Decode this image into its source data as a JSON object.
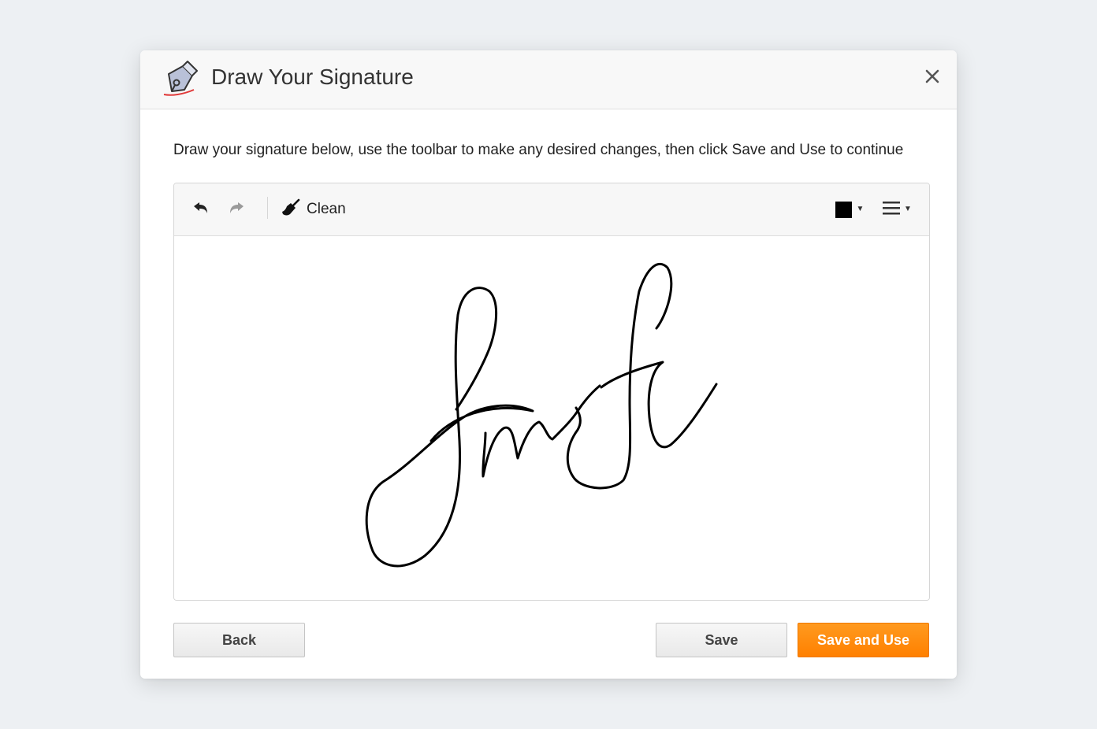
{
  "dialog": {
    "title": "Draw Your Signature",
    "close_icon": "close-icon",
    "header_icon": "pen-nib-icon"
  },
  "instruction": "Draw your signature below, use the toolbar to make any desired changes, then click Save and Use to continue",
  "toolbar": {
    "undo_icon": "undo-icon",
    "redo_icon": "redo-icon",
    "clean_icon": "broom-icon",
    "clean_label": "Clean",
    "pen_color": "#000000",
    "line_width_icon": "line-width-icon"
  },
  "footer": {
    "back_label": "Back",
    "save_label": "Save",
    "save_and_use_label": "Save and Use"
  },
  "colors": {
    "accent": "#ff8a00",
    "ink": "#000000"
  }
}
